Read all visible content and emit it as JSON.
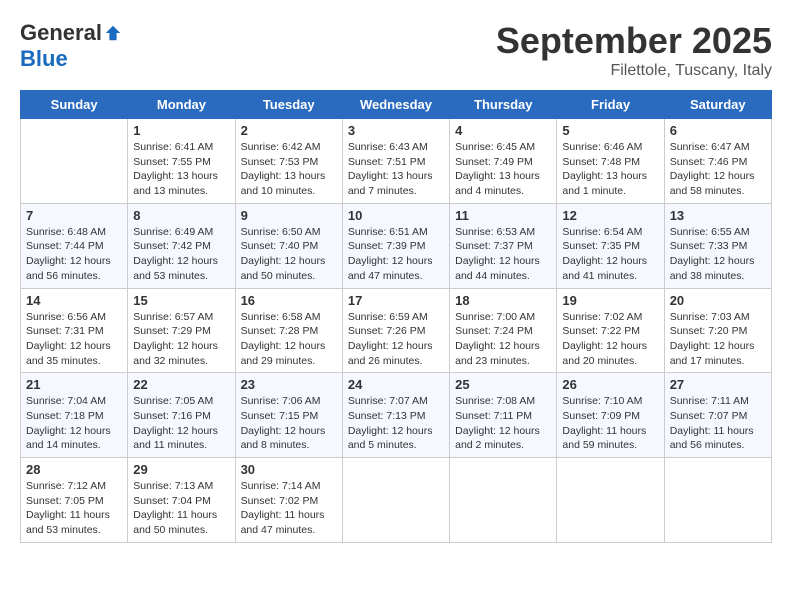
{
  "header": {
    "logo_general": "General",
    "logo_blue": "Blue",
    "month_title": "September 2025",
    "subtitle": "Filettole, Tuscany, Italy"
  },
  "weekdays": [
    "Sunday",
    "Monday",
    "Tuesday",
    "Wednesday",
    "Thursday",
    "Friday",
    "Saturday"
  ],
  "weeks": [
    [
      {
        "day": null,
        "info": null
      },
      {
        "day": "1",
        "info": "Sunrise: 6:41 AM\nSunset: 7:55 PM\nDaylight: 13 hours\nand 13 minutes."
      },
      {
        "day": "2",
        "info": "Sunrise: 6:42 AM\nSunset: 7:53 PM\nDaylight: 13 hours\nand 10 minutes."
      },
      {
        "day": "3",
        "info": "Sunrise: 6:43 AM\nSunset: 7:51 PM\nDaylight: 13 hours\nand 7 minutes."
      },
      {
        "day": "4",
        "info": "Sunrise: 6:45 AM\nSunset: 7:49 PM\nDaylight: 13 hours\nand 4 minutes."
      },
      {
        "day": "5",
        "info": "Sunrise: 6:46 AM\nSunset: 7:48 PM\nDaylight: 13 hours\nand 1 minute."
      },
      {
        "day": "6",
        "info": "Sunrise: 6:47 AM\nSunset: 7:46 PM\nDaylight: 12 hours\nand 58 minutes."
      }
    ],
    [
      {
        "day": "7",
        "info": "Sunrise: 6:48 AM\nSunset: 7:44 PM\nDaylight: 12 hours\nand 56 minutes."
      },
      {
        "day": "8",
        "info": "Sunrise: 6:49 AM\nSunset: 7:42 PM\nDaylight: 12 hours\nand 53 minutes."
      },
      {
        "day": "9",
        "info": "Sunrise: 6:50 AM\nSunset: 7:40 PM\nDaylight: 12 hours\nand 50 minutes."
      },
      {
        "day": "10",
        "info": "Sunrise: 6:51 AM\nSunset: 7:39 PM\nDaylight: 12 hours\nand 47 minutes."
      },
      {
        "day": "11",
        "info": "Sunrise: 6:53 AM\nSunset: 7:37 PM\nDaylight: 12 hours\nand 44 minutes."
      },
      {
        "day": "12",
        "info": "Sunrise: 6:54 AM\nSunset: 7:35 PM\nDaylight: 12 hours\nand 41 minutes."
      },
      {
        "day": "13",
        "info": "Sunrise: 6:55 AM\nSunset: 7:33 PM\nDaylight: 12 hours\nand 38 minutes."
      }
    ],
    [
      {
        "day": "14",
        "info": "Sunrise: 6:56 AM\nSunset: 7:31 PM\nDaylight: 12 hours\nand 35 minutes."
      },
      {
        "day": "15",
        "info": "Sunrise: 6:57 AM\nSunset: 7:29 PM\nDaylight: 12 hours\nand 32 minutes."
      },
      {
        "day": "16",
        "info": "Sunrise: 6:58 AM\nSunset: 7:28 PM\nDaylight: 12 hours\nand 29 minutes."
      },
      {
        "day": "17",
        "info": "Sunrise: 6:59 AM\nSunset: 7:26 PM\nDaylight: 12 hours\nand 26 minutes."
      },
      {
        "day": "18",
        "info": "Sunrise: 7:00 AM\nSunset: 7:24 PM\nDaylight: 12 hours\nand 23 minutes."
      },
      {
        "day": "19",
        "info": "Sunrise: 7:02 AM\nSunset: 7:22 PM\nDaylight: 12 hours\nand 20 minutes."
      },
      {
        "day": "20",
        "info": "Sunrise: 7:03 AM\nSunset: 7:20 PM\nDaylight: 12 hours\nand 17 minutes."
      }
    ],
    [
      {
        "day": "21",
        "info": "Sunrise: 7:04 AM\nSunset: 7:18 PM\nDaylight: 12 hours\nand 14 minutes."
      },
      {
        "day": "22",
        "info": "Sunrise: 7:05 AM\nSunset: 7:16 PM\nDaylight: 12 hours\nand 11 minutes."
      },
      {
        "day": "23",
        "info": "Sunrise: 7:06 AM\nSunset: 7:15 PM\nDaylight: 12 hours\nand 8 minutes."
      },
      {
        "day": "24",
        "info": "Sunrise: 7:07 AM\nSunset: 7:13 PM\nDaylight: 12 hours\nand 5 minutes."
      },
      {
        "day": "25",
        "info": "Sunrise: 7:08 AM\nSunset: 7:11 PM\nDaylight: 12 hours\nand 2 minutes."
      },
      {
        "day": "26",
        "info": "Sunrise: 7:10 AM\nSunset: 7:09 PM\nDaylight: 11 hours\nand 59 minutes."
      },
      {
        "day": "27",
        "info": "Sunrise: 7:11 AM\nSunset: 7:07 PM\nDaylight: 11 hours\nand 56 minutes."
      }
    ],
    [
      {
        "day": "28",
        "info": "Sunrise: 7:12 AM\nSunset: 7:05 PM\nDaylight: 11 hours\nand 53 minutes."
      },
      {
        "day": "29",
        "info": "Sunrise: 7:13 AM\nSunset: 7:04 PM\nDaylight: 11 hours\nand 50 minutes."
      },
      {
        "day": "30",
        "info": "Sunrise: 7:14 AM\nSunset: 7:02 PM\nDaylight: 11 hours\nand 47 minutes."
      },
      {
        "day": null,
        "info": null
      },
      {
        "day": null,
        "info": null
      },
      {
        "day": null,
        "info": null
      },
      {
        "day": null,
        "info": null
      }
    ]
  ]
}
